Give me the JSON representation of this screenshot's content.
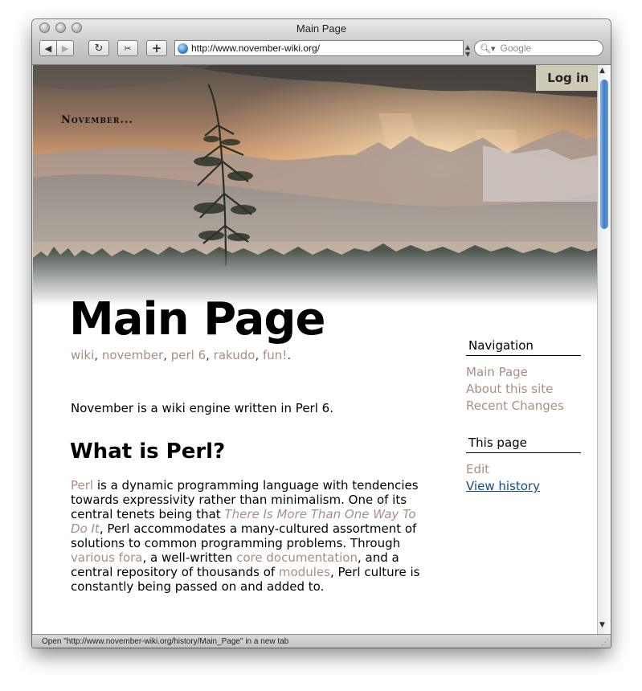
{
  "window": {
    "title": "Main Page"
  },
  "toolbar": {
    "back_icon": "back-arrow-icon",
    "forward_icon": "forward-arrow-icon",
    "reload_icon": "reload-icon",
    "snipe_icon": "snipback-icon",
    "add_label": "+",
    "url": "http://www.november-wiki.org/",
    "search_placeholder": "Google"
  },
  "header": {
    "site_name": "November...",
    "login_label": "Log in"
  },
  "main": {
    "title": "Main Page",
    "tags": [
      "wiki",
      "november",
      "perl 6",
      "rakudo",
      "fun!"
    ],
    "intro": "November is a wiki engine written in Perl 6.",
    "section_heading": "What is Perl?",
    "paragraph": {
      "link_perl": "Perl",
      "t1": " is a dynamic programming language with tendencies towards expressivity rather than minimalism. One of its central tenets being that ",
      "link_timtowtdi": "There Is More Than One Way To Do It",
      "t2": ", Perl accommodates a many-cultured assortment of solutions to common programming problems. Through ",
      "link_fora": "various fora",
      "t3": ", a well-written ",
      "link_core_doc": "core documentation",
      "t4": ", and a central repository of thousands of ",
      "link_modules": "modules",
      "t5": ", Perl culture is constantly being passed on and added to."
    }
  },
  "sidebar": {
    "navigation": {
      "heading": "Navigation",
      "items": [
        "Main Page",
        "About this site",
        "Recent Changes"
      ]
    },
    "this_page": {
      "heading": "This page",
      "items": [
        "Edit",
        "View history"
      ]
    }
  },
  "statusbar": {
    "text": "Open \"http://www.november-wiki.org/history/Main_Page\" in a new tab"
  },
  "colors": {
    "link": "#a98f83",
    "visited_link": "#1a4a82",
    "login_bg": "#dad6c0"
  }
}
